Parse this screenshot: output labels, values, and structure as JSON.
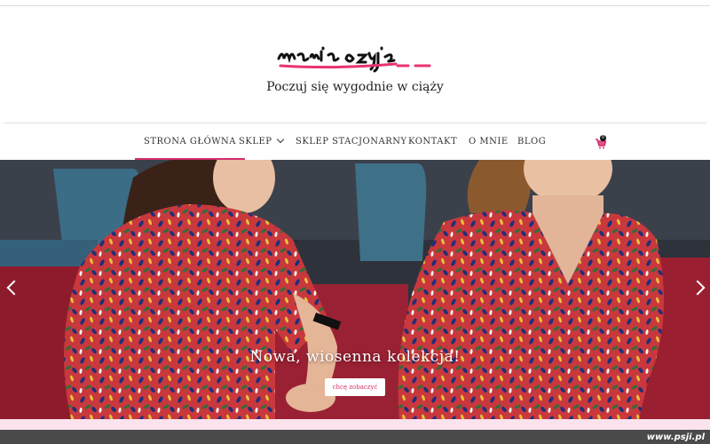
{
  "header": {
    "logo_text": "maria szyje",
    "tagline": "Poczuj się wygodnie w ciąży"
  },
  "nav": {
    "items": [
      {
        "label": "STRONA GŁÓWNA",
        "active": true
      },
      {
        "label": "SKLEP",
        "has_dropdown": true
      },
      {
        "label": "SKLEP STACJONARNY"
      },
      {
        "label": "KONTAKT"
      },
      {
        "label": "O MNIE"
      },
      {
        "label": "BLOG"
      }
    ],
    "cart_count": "0",
    "cart_icon": "shopping-cart-icon"
  },
  "hero": {
    "title": "Nowa, wiosenna kolekcja!",
    "button_label": "chcę zobaczyć",
    "prev_icon": "chevron-left-icon",
    "next_icon": "chevron-right-icon"
  },
  "footer": {
    "watermark": "www.psji.pl"
  },
  "colors": {
    "accent": "#d22f6e",
    "pink_band": "#fbe3ee",
    "dark_bar": "#4a4a4a"
  }
}
